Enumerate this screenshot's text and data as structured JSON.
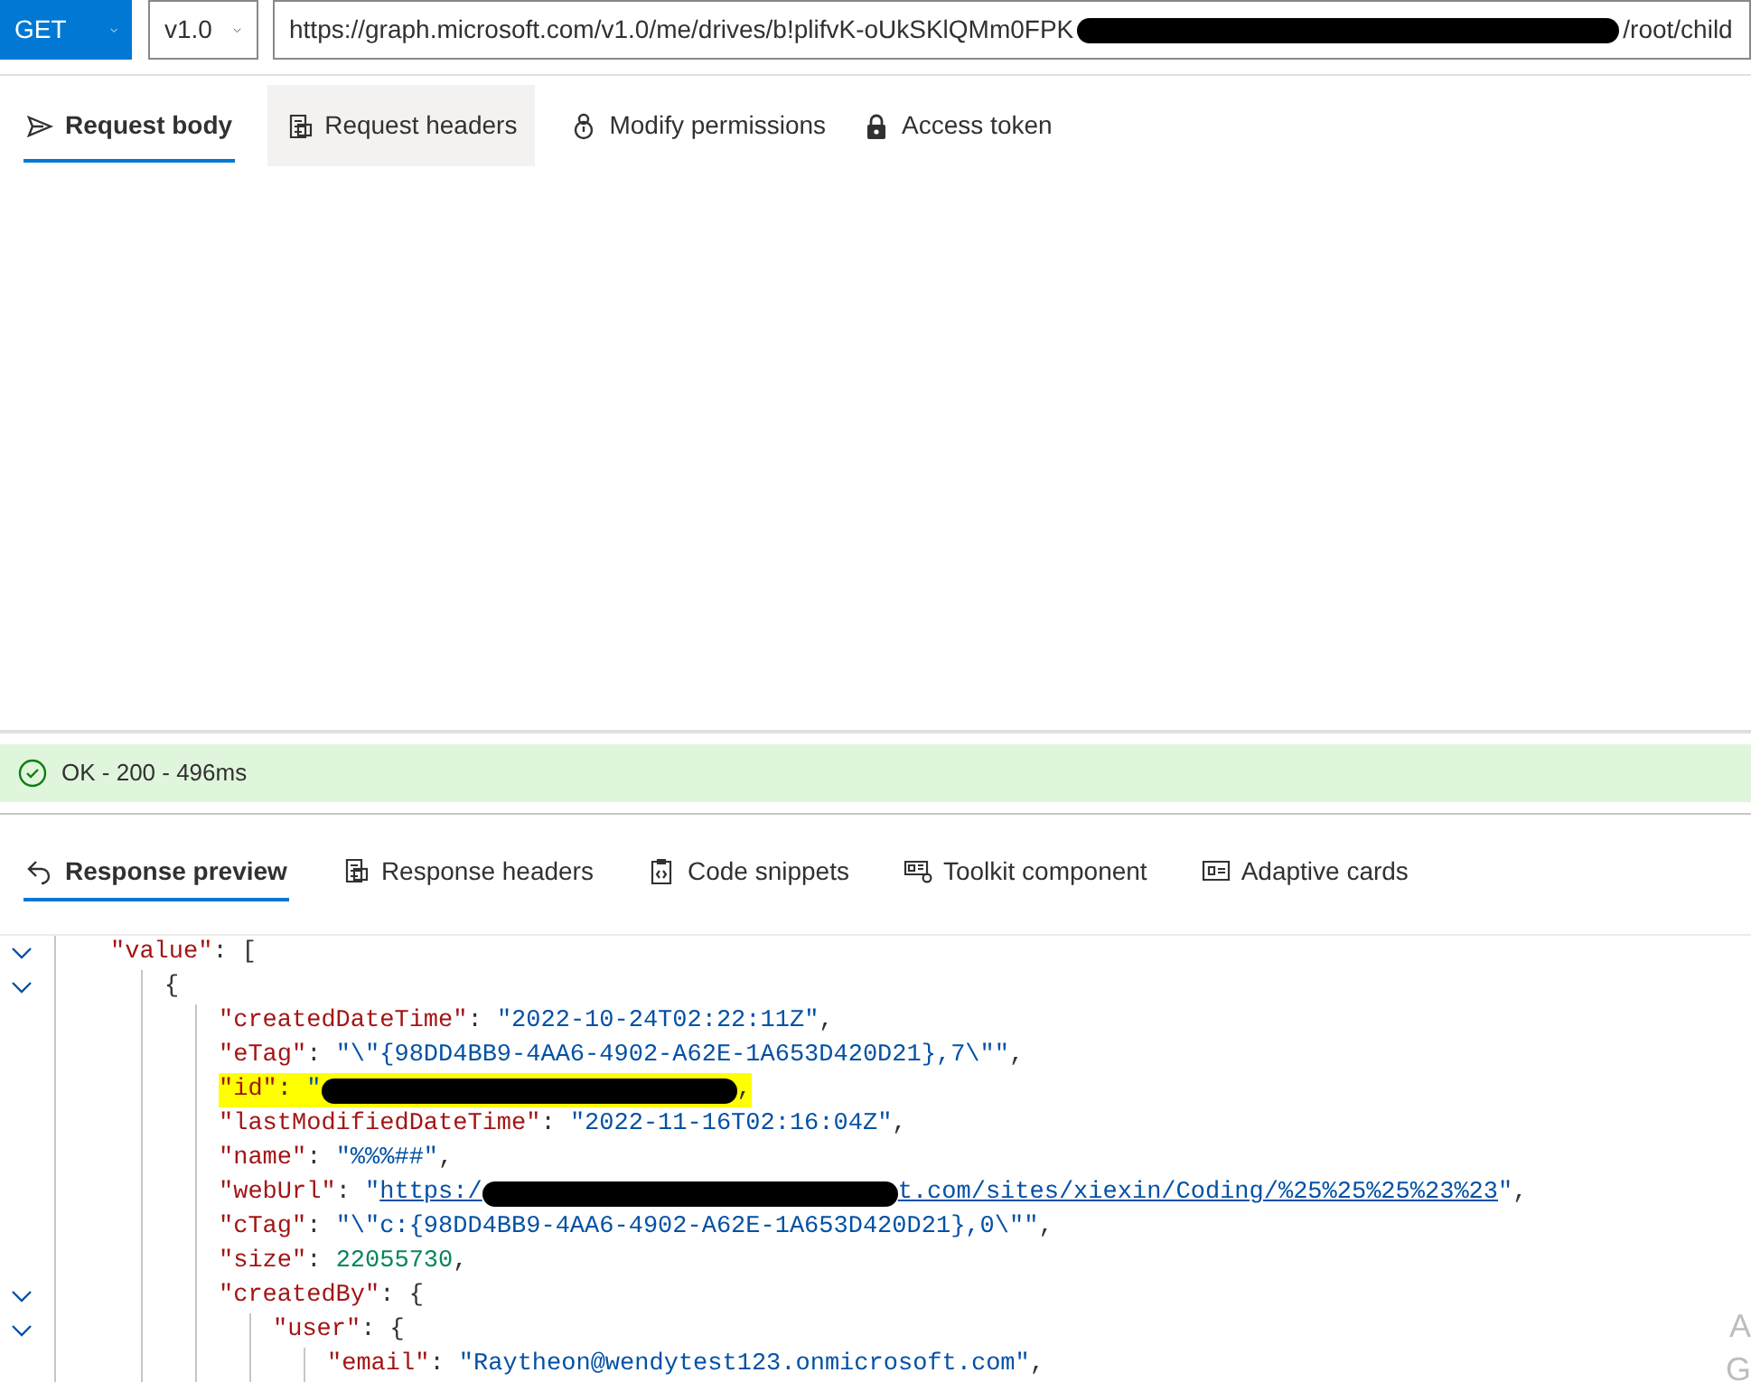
{
  "request": {
    "method": "GET",
    "version": "v1.0",
    "url_start": "https://graph.microsoft.com/v1.0/me/drives/b!plifvK-oUkSKlQMm0FPK",
    "url_end": "/root/child"
  },
  "request_tabs": [
    {
      "label": "Request body",
      "selected": true,
      "hovered": false
    },
    {
      "label": "Request headers",
      "selected": false,
      "hovered": true
    },
    {
      "label": "Modify permissions",
      "selected": false,
      "hovered": false
    },
    {
      "label": "Access token",
      "selected": false,
      "hovered": false
    }
  ],
  "status": {
    "kind": "success",
    "text": "OK - 200 - 496ms"
  },
  "response_tabs": [
    {
      "label": "Response preview",
      "selected": true
    },
    {
      "label": "Response headers",
      "selected": false
    },
    {
      "label": "Code snippets",
      "selected": false
    },
    {
      "label": "Toolkit component",
      "selected": false
    },
    {
      "label": "Adaptive cards",
      "selected": false
    }
  ],
  "response_lines": [
    {
      "highlighted": false,
      "segments": [
        {
          "kind": "key",
          "text": "\"value\""
        },
        {
          "kind": "punct",
          "text": ": ["
        }
      ],
      "children": [
        {
          "highlighted": false,
          "segments": [
            {
              "kind": "punct",
              "text": "{"
            }
          ],
          "children": [
            {
              "highlighted": false,
              "segments": [
                {
                  "kind": "key",
                  "text": "\"createdDateTime\""
                },
                {
                  "kind": "punct",
                  "text": ": "
                },
                {
                  "kind": "string",
                  "text": "\"2022-10-24T02:22:11Z\""
                },
                {
                  "kind": "punct",
                  "text": ","
                }
              ]
            },
            {
              "highlighted": false,
              "segments": [
                {
                  "kind": "key",
                  "text": "\"eTag\""
                },
                {
                  "kind": "punct",
                  "text": ": "
                },
                {
                  "kind": "string",
                  "text": "\"\\\"{98DD4BB9-4AA6-4902-A62E-1A653D420D21},7\\\"\""
                },
                {
                  "kind": "punct",
                  "text": ","
                }
              ]
            },
            {
              "highlighted": true,
              "segments": [
                {
                  "kind": "key",
                  "text": "\"id\""
                },
                {
                  "kind": "punct",
                  "text": ": "
                },
                {
                  "kind": "string",
                  "text": "\""
                },
                {
                  "kind": "redaction"
                },
                {
                  "kind": "punct",
                  "text": ","
                }
              ]
            },
            {
              "highlighted": false,
              "segments": [
                {
                  "kind": "key",
                  "text": "\"lastModifiedDateTime\""
                },
                {
                  "kind": "punct",
                  "text": ": "
                },
                {
                  "kind": "string",
                  "text": "\"2022-11-16T02:16:04Z\""
                },
                {
                  "kind": "punct",
                  "text": ","
                }
              ]
            },
            {
              "highlighted": false,
              "segments": [
                {
                  "kind": "key",
                  "text": "\"name\""
                },
                {
                  "kind": "punct",
                  "text": ": "
                },
                {
                  "kind": "string",
                  "text": "\"%%%##\""
                },
                {
                  "kind": "punct",
                  "text": ","
                }
              ]
            },
            {
              "highlighted": false,
              "segments": [
                {
                  "kind": "key",
                  "text": "\"webUrl\""
                },
                {
                  "kind": "punct",
                  "text": ": "
                },
                {
                  "kind": "string",
                  "text": "\""
                },
                {
                  "kind": "link",
                  "text": "https:/"
                },
                {
                  "kind": "redaction"
                },
                {
                  "kind": "link",
                  "text": "t.com/sites/xiexin/Coding/%25%25%25%23%23"
                },
                {
                  "kind": "string",
                  "text": "\""
                },
                {
                  "kind": "punct",
                  "text": ","
                }
              ]
            },
            {
              "highlighted": false,
              "segments": [
                {
                  "kind": "key",
                  "text": "\"cTag\""
                },
                {
                  "kind": "punct",
                  "text": ": "
                },
                {
                  "kind": "string",
                  "text": "\"\\\"c:{98DD4BB9-4AA6-4902-A62E-1A653D420D21},0\\\"\""
                },
                {
                  "kind": "punct",
                  "text": ","
                }
              ]
            },
            {
              "highlighted": false,
              "segments": [
                {
                  "kind": "key",
                  "text": "\"size\""
                },
                {
                  "kind": "punct",
                  "text": ": "
                },
                {
                  "kind": "number",
                  "text": "22055730"
                },
                {
                  "kind": "punct",
                  "text": ","
                }
              ]
            },
            {
              "highlighted": false,
              "segments": [
                {
                  "kind": "key",
                  "text": "\"createdBy\""
                },
                {
                  "kind": "punct",
                  "text": ": {"
                }
              ],
              "children": [
                {
                  "highlighted": false,
                  "segments": [
                    {
                      "kind": "key",
                      "text": "\"user\""
                    },
                    {
                      "kind": "punct",
                      "text": ": {"
                    }
                  ],
                  "children": [
                    {
                      "highlighted": false,
                      "segments": [
                        {
                          "kind": "key",
                          "text": "\"email\""
                        },
                        {
                          "kind": "punct",
                          "text": ": "
                        },
                        {
                          "kind": "string",
                          "text": "\"Raytheon@wendytest123.onmicrosoft.com\""
                        },
                        {
                          "kind": "punct",
                          "text": ","
                        }
                      ]
                    }
                  ]
                }
              ]
            }
          ]
        }
      ]
    }
  ],
  "overlay_letters": [
    "A",
    "G"
  ]
}
